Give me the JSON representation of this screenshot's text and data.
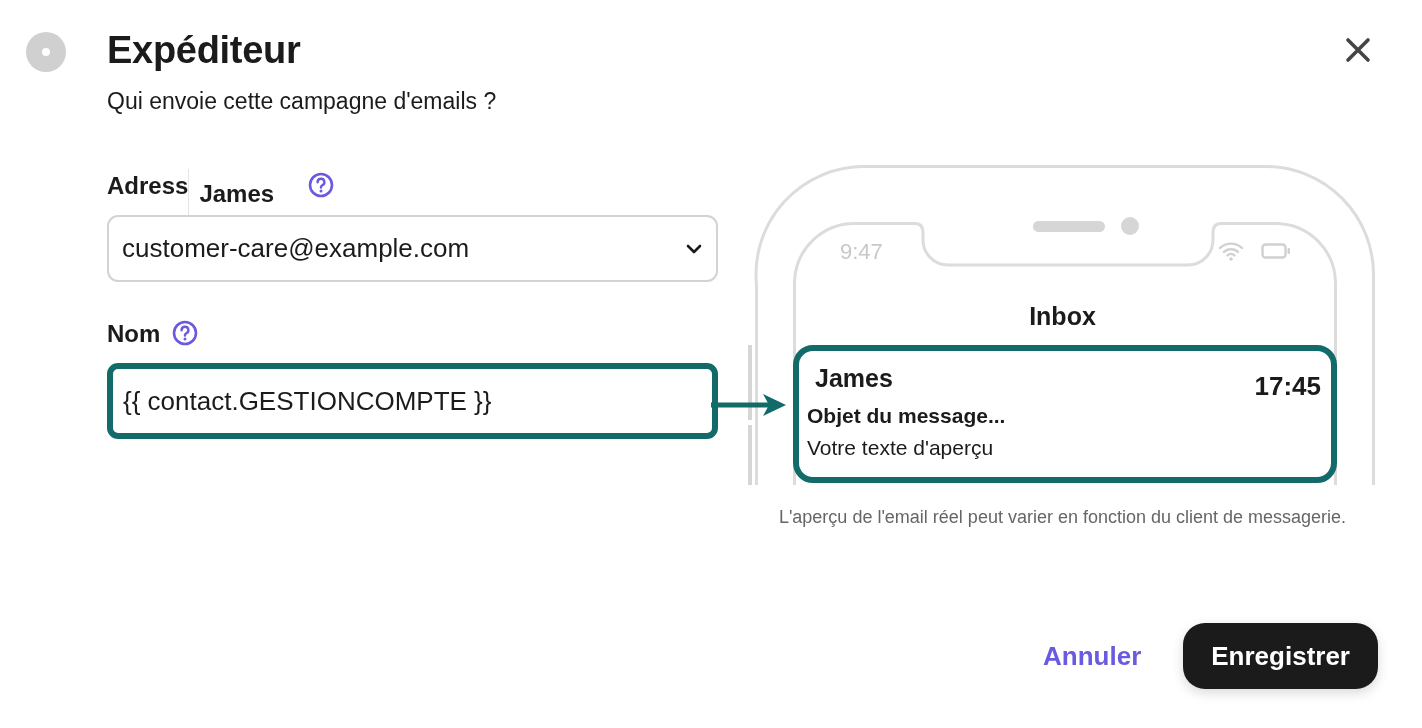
{
  "header": {
    "title": "Expéditeur",
    "subtitle": "Qui envoie cette campagne d'emails ?"
  },
  "fields": [
    {
      "kind": "select",
      "label": "Adress",
      "overlay": "James",
      "value": "customer-care@example.com",
      "highlighted": false
    },
    {
      "kind": "text",
      "label": "Nom",
      "value": "{{ contact.GESTIONCOMPTE }}",
      "highlighted": true
    }
  ],
  "preview": {
    "status_time": "9:47",
    "title": "Inbox",
    "email": {
      "sender": "James",
      "time": "17:45",
      "subject": "Objet du message...",
      "preview_text": "Votre texte d'aperçu"
    },
    "note": "L'aperçu de l'email réel peut varier en fonction du client de messagerie."
  },
  "buttons": [
    {
      "kind": "link",
      "label": "Annuler"
    },
    {
      "kind": "primary",
      "label": "Enregistrer"
    }
  ]
}
